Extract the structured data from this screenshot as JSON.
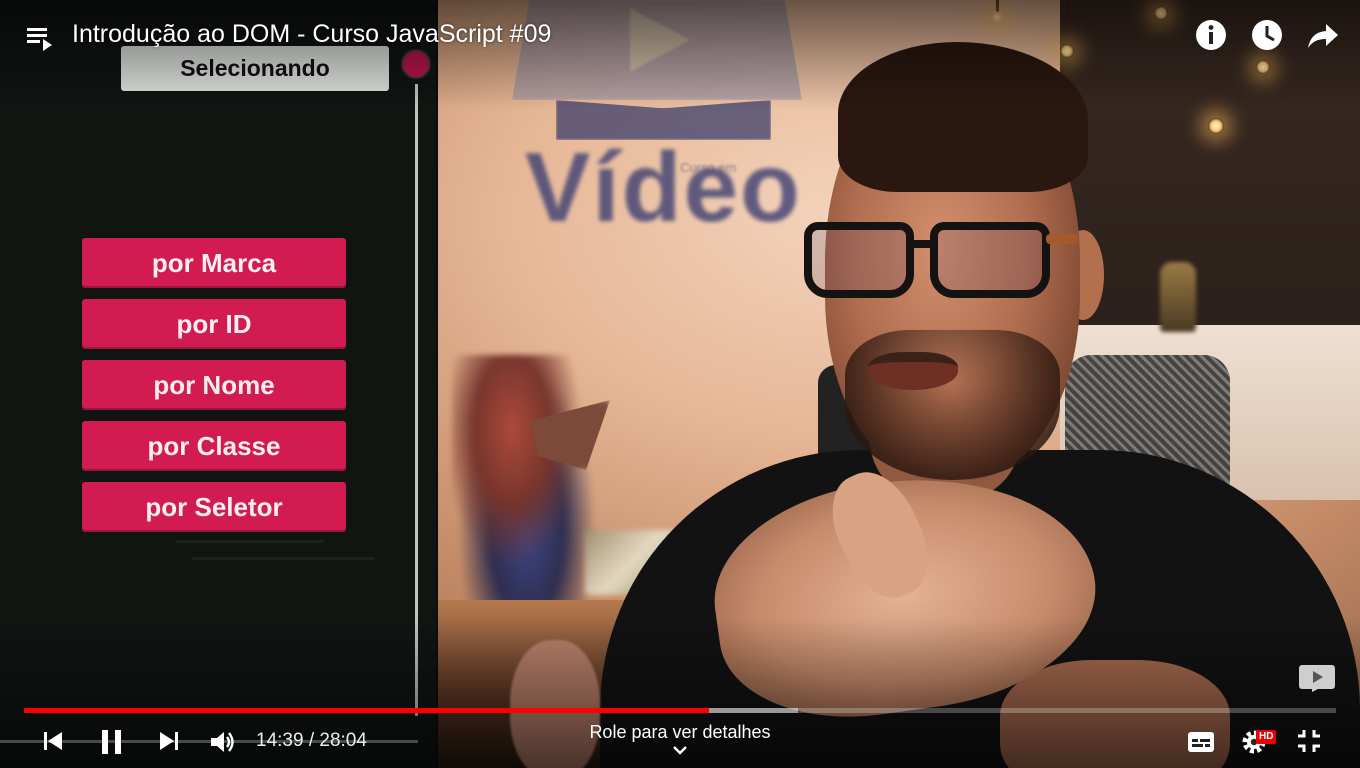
{
  "player": {
    "title": "Introdução ao DOM - Curso JavaScript #09",
    "playlist_icon": "playlist-icon",
    "top_actions": [
      {
        "name": "info-icon"
      },
      {
        "name": "watch-later-icon"
      },
      {
        "name": "share-icon"
      }
    ]
  },
  "overlay": {
    "heading": "Selecionando",
    "methods": [
      "por Marca",
      "por ID",
      "por Nome",
      "por Classe",
      "por Seletor"
    ],
    "accent_color": "#d21b50"
  },
  "scene": {
    "wall_logo_word": "Vídeo",
    "wall_logo_small": "Curso em"
  },
  "progress": {
    "played_fraction": 0.522,
    "buffered_fraction": 0.59,
    "played_color": "#ff0000"
  },
  "controls": {
    "current_time": "14:39",
    "separator": " / ",
    "duration": "28:04",
    "scroll_hint": "Role para ver detalhes",
    "quality_badge": "HD",
    "icons": [
      "previous-icon",
      "pause-icon",
      "next-icon",
      "volume-icon",
      "subtitles-icon",
      "settings-icon",
      "exit-fullscreen-icon"
    ]
  }
}
